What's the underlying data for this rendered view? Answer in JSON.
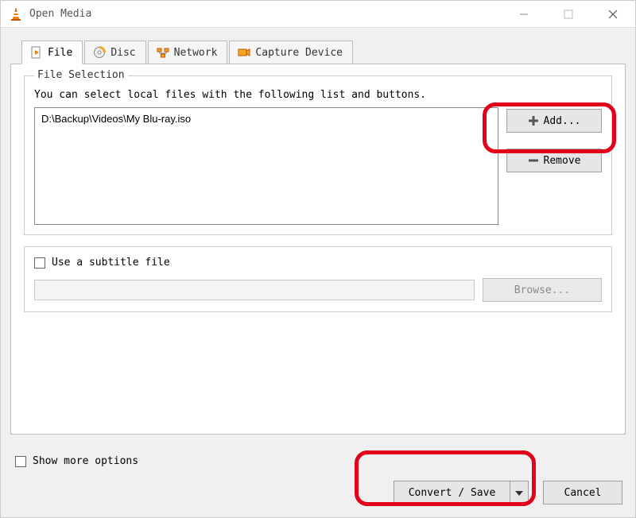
{
  "window": {
    "title": "Open Media"
  },
  "tabs": {
    "file": {
      "label": "File"
    },
    "disc": {
      "label": "Disc"
    },
    "network": {
      "label": "Network"
    },
    "capture": {
      "label": "Capture Device"
    }
  },
  "fileSelection": {
    "legend": "File Selection",
    "hint": "You can select local files with the following list and buttons.",
    "files": [
      "D:\\Backup\\Videos\\My Blu-ray.iso"
    ],
    "add_label": "Add...",
    "remove_label": "Remove"
  },
  "subtitle": {
    "checkbox_label": "Use a subtitle file",
    "browse_label": "Browse...",
    "path": ""
  },
  "footer": {
    "show_more_label": "Show more options",
    "convert_label": "Convert / Save",
    "cancel_label": "Cancel"
  }
}
